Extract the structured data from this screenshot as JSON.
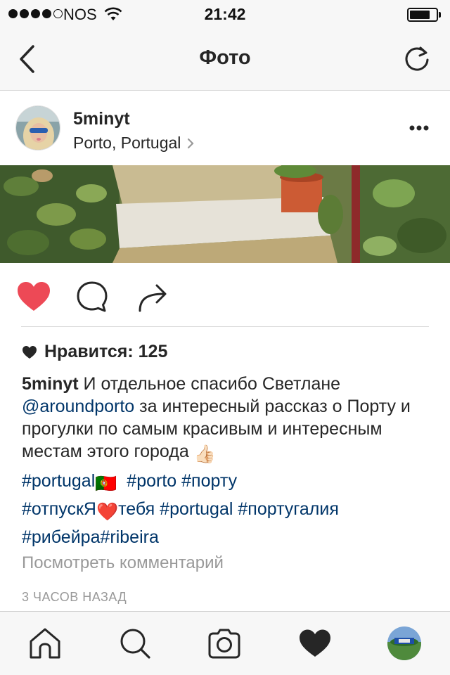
{
  "status_bar": {
    "carrier": "NOS",
    "time": "21:42",
    "signal_bars": 4,
    "signal_total": 5,
    "battery_level": 0.8
  },
  "nav": {
    "title": "Фото",
    "back_icon": "chevron-left-icon",
    "refresh_icon": "refresh-icon"
  },
  "post": {
    "username": "5minyt",
    "location": "Porto, Portugal",
    "likes_label": "Нравится: 125",
    "caption": {
      "user": "5minyt",
      "text_1": " И отдельное спасибо Светлане",
      "mention": "@aroundporto",
      "text_2": "  за интересный рассказ о Порту и прогулки по самым красивым и интересным местам этого города ",
      "thumbs_emoji": "👍🏻"
    },
    "tags": {
      "t1": "#portugal",
      "flag_emoji": "🇵🇹",
      "t2": "#porto",
      "t3": "#порту",
      "t4a": "#отпускЯ",
      "heart_emoji": "❤️",
      "t4b": "тебя",
      "t5": "#portugal",
      "t6": "#португалия",
      "t7": "#рибейра",
      "t8": "#ribeira"
    },
    "view_comments": "Посмотреть комментарий",
    "timestamp": "3 ЧАСОВ НАЗАД",
    "liked": true
  },
  "colors": {
    "like_red": "#ed4956",
    "link_blue": "#003569",
    "muted_gray": "#999999",
    "bar_bg": "#f7f7f7"
  },
  "tabs": [
    "home-icon",
    "search-icon",
    "camera-icon",
    "activity-heart-icon",
    "profile-avatar"
  ]
}
